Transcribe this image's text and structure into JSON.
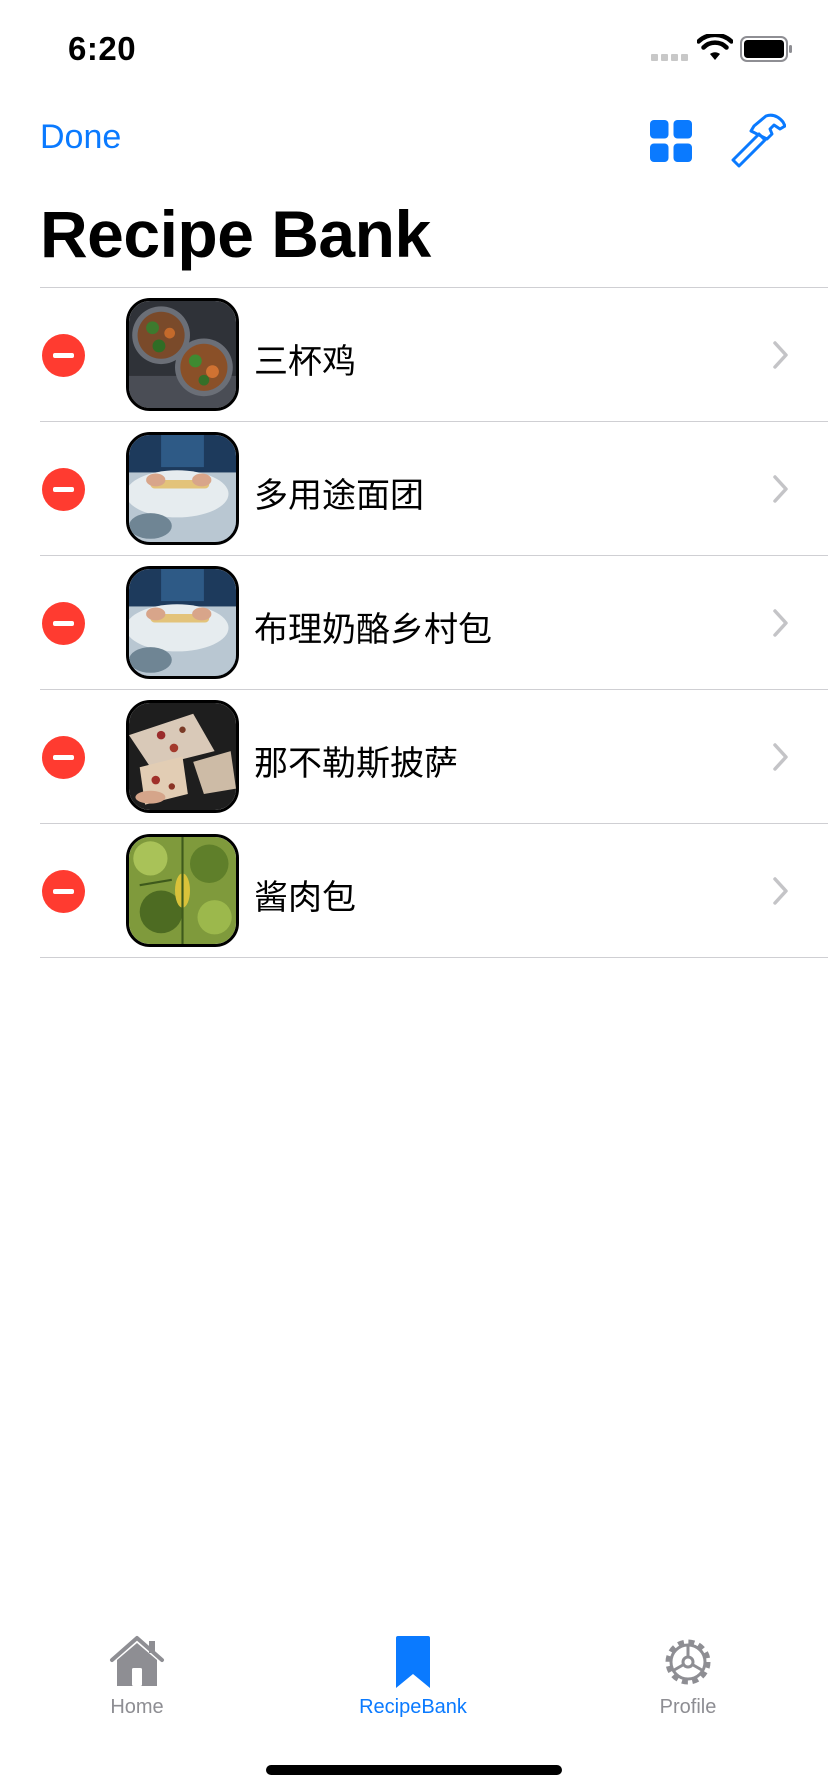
{
  "status_bar": {
    "time": "6:20"
  },
  "nav": {
    "done_label": "Done",
    "title": "Recipe Bank",
    "grid_icon": "grid-icon",
    "hammer_icon": "hammer-icon"
  },
  "recipes": [
    {
      "name": "三杯鸡",
      "thumbnail": "dish-bowls-photo"
    },
    {
      "name": "多用途面团",
      "thumbnail": "dough-rolling-photo"
    },
    {
      "name": "布理奶酪乡村包",
      "thumbnail": "dough-rolling-photo"
    },
    {
      "name": "那不勒斯披萨",
      "thumbnail": "pizza-slices-photo"
    },
    {
      "name": "酱肉包",
      "thumbnail": "green-plant-photo"
    }
  ],
  "tabs": [
    {
      "label": "Home",
      "icon": "house-icon",
      "selected": false
    },
    {
      "label": "RecipeBank",
      "icon": "bookmark-icon",
      "selected": true
    },
    {
      "label": "Profile",
      "icon": "gear-icon",
      "selected": false
    }
  ],
  "colors": {
    "accent": "#0a7aff",
    "delete": "#ff3b30",
    "inactive_tab": "#8e8e93",
    "separator": "#cfcfd3"
  }
}
